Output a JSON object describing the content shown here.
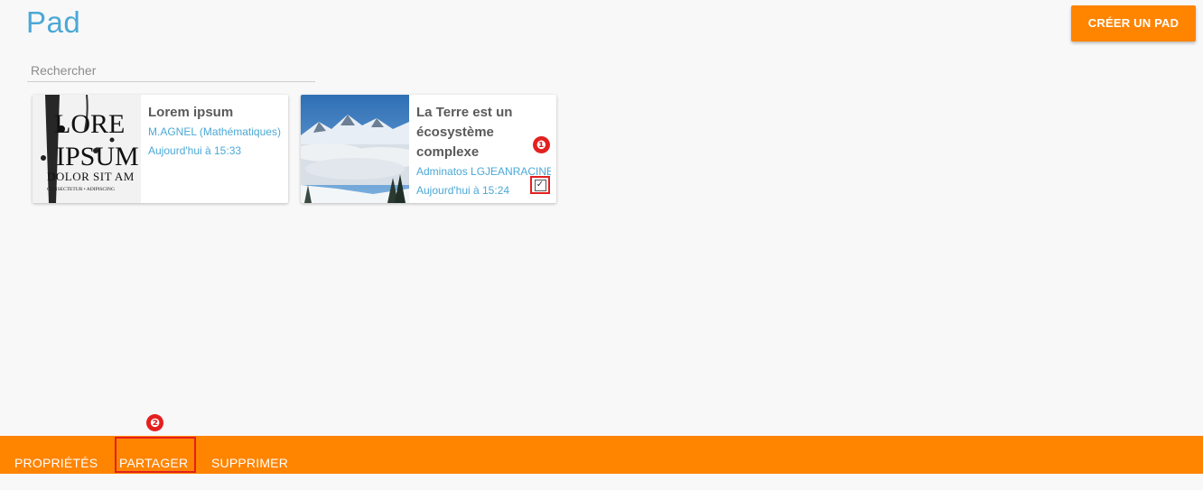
{
  "header": {
    "title": "Pad",
    "create_button": "CRÉER UN PAD"
  },
  "search": {
    "placeholder": "Rechercher",
    "value": ""
  },
  "pads": [
    {
      "title": "Lorem ipsum",
      "author": "M.AGNEL (Mathématiques)",
      "date": "Aujourd'hui à 15:33",
      "thumbnail": "lorem-ipsum-ink-image",
      "thumbnail_text": [
        "LORE",
        "IPSUM",
        "DOLOR SIT AM",
        "CONSECTETUR • ADIPISCING"
      ],
      "selected": false
    },
    {
      "title": "La Terre est un écosystème complexe",
      "author": "Adminatos LGJEANRACINE",
      "date": "Aujourd'hui à 15:24",
      "thumbnail": "mountain-sea-of-clouds-image",
      "selected": true
    }
  ],
  "annotations": {
    "step_1": "❶",
    "step_2": "❷"
  },
  "actions": {
    "properties": "PROPRIÉTÉS",
    "share": "PARTAGER",
    "delete": "SUPPRIMER"
  },
  "colors": {
    "accent": "#ff8400",
    "title_blue": "#4ba8d6",
    "highlight_red": "#e3201f",
    "background": "#f8f8f8"
  }
}
